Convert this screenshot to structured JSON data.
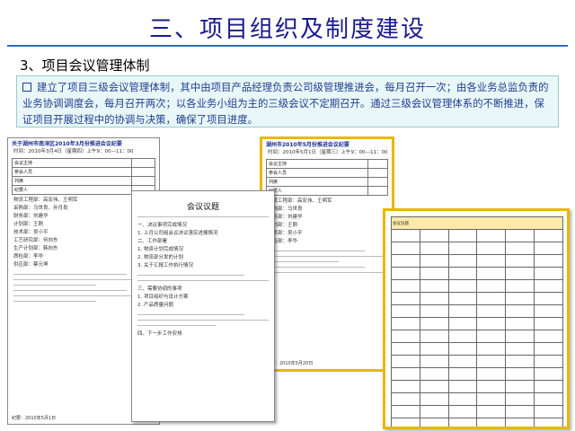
{
  "slide": {
    "title": "三、项目组织及制度建设",
    "subtitle": "3、项目会议管理体制",
    "intro": "建立了项目三级会议管理体制，其中由项目产品经理负责公司级管理推进会，每月召开一次；由各业务总监负责的业务协调调度会，每月召开两次；以各业务小组为主的三级会议不定期召开。通过三级会议管理体系的不断推进，保证项目开展过程中的协调与决策，确保了项目进度。"
  },
  "docs": {
    "doc_a": {
      "header": "关于湖州市南浔区2010年3月份推进会议纪要",
      "meta": "时间：2010年3月4日（星期四）上午9：00—11：00",
      "rows": [
        "会议主持",
        "参会人员",
        "列席",
        "纪要人"
      ],
      "lines": [
        "物流工程部：高宏伟、王明军",
        "采购部：马世良、孙月良",
        "财务部：刘建华",
        "计划部：王刚",
        "技术部：吴小平",
        "工艺研究部：何向东",
        "生产计划部：韩向东",
        "质检部：李华",
        "供应部：蔡元坤"
      ],
      "footer": "纪要：2010年5月1日"
    },
    "doc_b": {
      "title": "会议议题",
      "lines": [
        "一、决议事项完成情况",
        "1. 上月公司组会议决议落实进展情况",
        "二、工作部署",
        "1. 物资计划完成情况",
        "2. 物流部分发的计划",
        "3. 关于汇报工作执行情况",
        "三、需要协调的事项",
        "1. 项目组织与设计方案",
        "2. 产品质量问题",
        "四、下一步工作安排"
      ]
    },
    "doc_c": {
      "header": "湖州市2010年5月份推进会议纪要",
      "meta": "时间：2010年5月1日（星期三）上午9：00—11：00",
      "rows": [
        "会议主持",
        "参会人员",
        "列席",
        "纪要人"
      ],
      "lines": [
        "物流工程部：高宏伟、王明军",
        "采购部：马世良",
        "财务部：刘建华",
        "计划部：王刚",
        "技术部：吴小平",
        "质检部：李华"
      ],
      "footer": "纪要：2010年5月20日"
    },
    "doc_d": {
      "header": "会议议题",
      "rows": 16
    }
  }
}
